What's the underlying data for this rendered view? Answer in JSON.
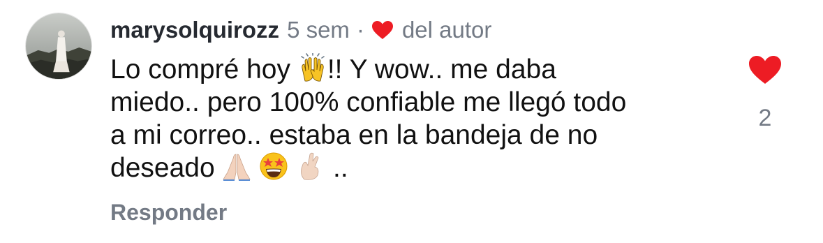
{
  "comment": {
    "username": "marysolquirozz",
    "time": "5 sem",
    "separator": "·",
    "author_tag": "del autor",
    "text_lines": [
      [
        "Lo compré hoy ",
        "!! Y wow.. me daba"
      ],
      [
        "miedo.. pero 100% confiable me llegó todo"
      ],
      [
        "a mi correo.. estaba en la bandeja de no"
      ],
      [
        "deseado ",
        " .."
      ]
    ],
    "emojis": [
      "raising-hands-emoji",
      "folded-hands-emoji",
      "star-struck-emoji",
      "crossed-fingers-emoji"
    ],
    "reply_label": "Responder",
    "like_count": "2"
  },
  "colors": {
    "heart_red": "#ed1c24",
    "meta_gray": "#737a85",
    "text_black": "#111111"
  }
}
